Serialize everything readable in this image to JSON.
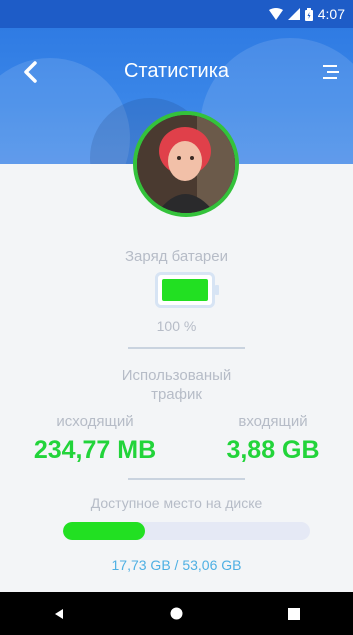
{
  "status_bar": {
    "time": "4:07"
  },
  "header": {
    "title": "Статистика"
  },
  "battery": {
    "label": "Заряд батареи",
    "percent_text": "100 %",
    "level": 1.0
  },
  "traffic": {
    "label": "Использованый трафик",
    "outgoing_label": "исходящий",
    "outgoing_value": "234,77 MB",
    "incoming_label": "входящий",
    "incoming_value": "3,88 GB"
  },
  "disk": {
    "label": "Доступное место на диске",
    "usage_text": "17,73 GB / 53,06 GB",
    "fraction": 0.334
  },
  "colors": {
    "accent": "#1e5cc7",
    "green": "#22e022",
    "value_green": "#22d43a",
    "link_blue": "#4fb0e3"
  }
}
